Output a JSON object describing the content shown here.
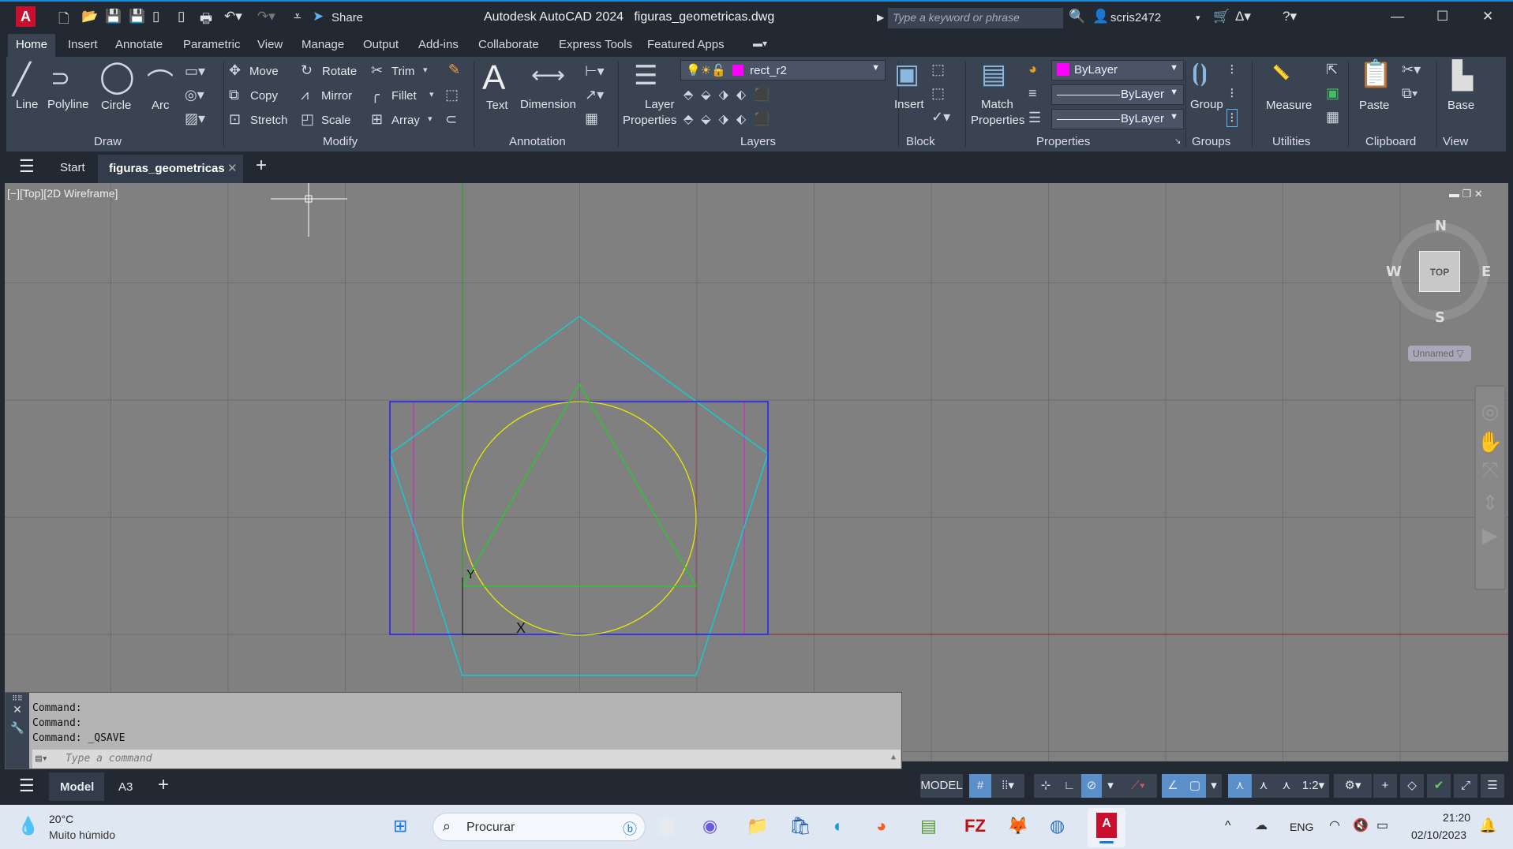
{
  "titlebar": {
    "app_title": "Autodesk AutoCAD 2024",
    "file_name": "figuras_geometricas.dwg",
    "share": "Share",
    "search_placeholder": "Type a keyword or phrase",
    "user": "scris2472"
  },
  "ribbon_tabs": [
    "Home",
    "Insert",
    "Annotate",
    "Parametric",
    "View",
    "Manage",
    "Output",
    "Add-ins",
    "Collaborate",
    "Express Tools",
    "Featured Apps"
  ],
  "draw": {
    "title": "Draw",
    "line": "Line",
    "polyline": "Polyline",
    "circle": "Circle",
    "arc": "Arc"
  },
  "modify": {
    "title": "Modify",
    "move": "Move",
    "rotate": "Rotate",
    "trim": "Trim",
    "copy": "Copy",
    "mirror": "Mirror",
    "fillet": "Fillet",
    "stretch": "Stretch",
    "scale": "Scale",
    "array": "Array"
  },
  "annotation": {
    "title": "Annotation",
    "text": "Text",
    "dimension": "Dimension"
  },
  "layers": {
    "title": "Layers",
    "layer_properties_1": "Layer",
    "layer_properties_2": "Properties",
    "current_layer": "rect_r2",
    "layer_color": "#ff00ff"
  },
  "block": {
    "title": "Block",
    "insert": "Insert"
  },
  "properties": {
    "title": "Properties",
    "match_1": "Match",
    "match_2": "Properties",
    "color": "ByLayer",
    "linetype": "ByLayer",
    "lineweight": "ByLayer"
  },
  "groups": {
    "title": "Groups",
    "group": "Group"
  },
  "utilities": {
    "title": "Utilities",
    "measure": "Measure"
  },
  "clipboard": {
    "title": "Clipboard",
    "paste": "Paste"
  },
  "view": {
    "title": "View",
    "base": "Base"
  },
  "doc_tabs": {
    "start": "Start",
    "active": "figuras_geometricas"
  },
  "viewport": {
    "label": "[−][Top][2D Wireframe]",
    "viewcube": {
      "top": "TOP",
      "n": "N",
      "s": "S",
      "e": "E",
      "w": "W"
    },
    "ucs_name": "Unnamed",
    "ucs_x": "X",
    "ucs_y": "Y"
  },
  "command": {
    "history": [
      "Command:",
      "Command:",
      "Command:  _QSAVE"
    ],
    "placeholder": "Type a command"
  },
  "layout_tabs": {
    "model": "Model",
    "a3": "A3"
  },
  "status": {
    "model": "MODEL",
    "scale": "1:2"
  },
  "taskbar": {
    "weather_temp": "20°C",
    "weather_desc": "Muito húmido",
    "search": "Procurar",
    "lang": "ENG",
    "time": "21:20",
    "date": "02/10/2023"
  },
  "colors": {
    "rectangle": "#2020ff",
    "pentagon": "#00d8d8",
    "circle": "#e8e800",
    "triangle": "#20d020",
    "vertical_lines": "#d020d0",
    "x_axis": "#a02020",
    "y_axis": "#20a020"
  }
}
